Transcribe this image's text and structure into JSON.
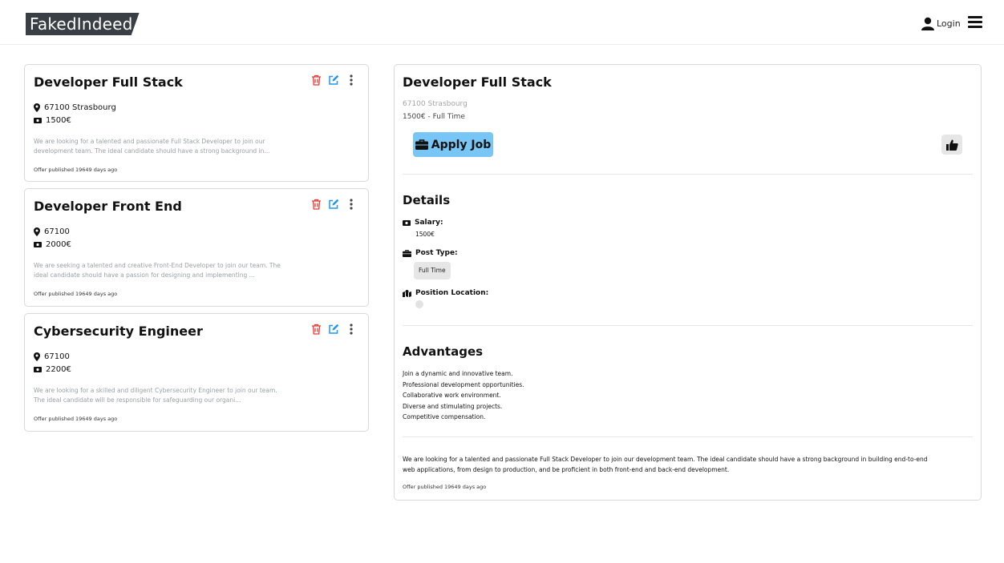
{
  "header": {
    "logo": "FakedIndeed",
    "login_label": "Login",
    "user_icon": "user-icon",
    "menu_icon": "hamburger-icon"
  },
  "jobs": [
    {
      "title": "Developer Full Stack",
      "location": "67100 Strasbourg",
      "salary": "1500€",
      "description_line1": "We are looking for a talented and passionate Full Stack Developer to join our",
      "description_line2": "development team. The ideal candidate should have a strong background in...",
      "published": "Offer published 19649 days ago"
    },
    {
      "title": "Developer Front End",
      "location": "67100",
      "salary": "2000€",
      "description_line1": "We are seeking a talented and creative Front-End Developer to join our team. The",
      "description_line2": "ideal candidate should have a passion for designing and implementing ...",
      "published": "Offer published 19649 days ago"
    },
    {
      "title": "Cybersecurity Engineer",
      "location": "67100",
      "salary": "2200€",
      "description_line1": "We are looking for a skilled and diligent Cybersecurity Engineer to join our team.",
      "description_line2": "The ideal candidate will be responsible for safeguarding our organi...",
      "published": "Offer published 19649 days ago"
    }
  ],
  "detail": {
    "title": "Developer Full Stack",
    "location": "67100 Strasbourg",
    "salary_line": "1500€ - Full Time",
    "apply_label": "Apply Job",
    "details_title": "Details",
    "salary_label": "Salary:",
    "salary_value": "1500€",
    "post_type_label": "Post Type:",
    "post_type_value": "Full Time",
    "position_location_label": "Position Location:",
    "advantages_title": "Advantages",
    "advantages": [
      "Join a dynamic and innovative team.",
      "Professional development opportunities.",
      "Collaborative work environment.",
      "Diverse and stimulating projects.",
      "Competitive compensation."
    ],
    "description_line1": "We are looking for a talented and passionate Full Stack Developer to join our development team. The ideal candidate should have a strong background in building end-to-end",
    "description_line2": "web applications, from design to production, and be proficient in both front-end and back-end development.",
    "published": "Offer published 19649 days ago"
  },
  "colors": {
    "delete": "#e53935",
    "edit": "#2196f3",
    "apply_bg": "#78c6f5",
    "logo_bg": "#3a3f46"
  }
}
